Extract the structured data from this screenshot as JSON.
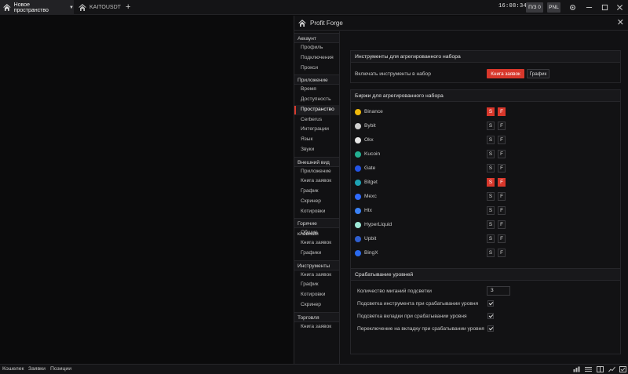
{
  "titlebar": {
    "workspace_tab": "Новое пространство",
    "symbol_tab": "KAITOUSDT",
    "clock": "16:08:34",
    "pz_button": "П/З 0",
    "pnl_button": "PNL"
  },
  "panel": {
    "title": "Profit Forge"
  },
  "nav": {
    "groups": [
      {
        "label": "Аккаунт",
        "items": [
          "Профиль",
          "Подключения",
          "Прокси"
        ]
      },
      {
        "label": "Приложение",
        "items": [
          "Время",
          "Доступность",
          "Пространство",
          "Cerberus",
          "Интеграции",
          "Язык",
          "Звуки"
        ]
      },
      {
        "label": "Внешний вид",
        "items": [
          "Приложение",
          "Книга заявок",
          "График",
          "Скринер",
          "Котировки"
        ]
      },
      {
        "label": "Горячие клавиши",
        "items": [
          "Общие",
          "Книга заявок",
          "Графики"
        ]
      },
      {
        "label": "Инструменты",
        "items": [
          "Книга заявок",
          "График",
          "Котировки",
          "Скринер"
        ]
      },
      {
        "label": "Торговля",
        "items": [
          "Книга заявок"
        ]
      }
    ],
    "active": "Пространство"
  },
  "instruments_section": {
    "title": "Инструменты для агрегированного набора",
    "row_label": "Включать инструменты в набор",
    "btn_orderbook": "Книга заявок",
    "btn_chart": "График",
    "orderbook_selected": true
  },
  "exchanges_section": {
    "title": "Биржи для агрегированного набора",
    "spot_label": "S",
    "futures_label": "F",
    "exchanges": [
      {
        "name": "Binance",
        "icon": "binance-icon",
        "color": "#f0b90b",
        "spot": true,
        "futures": true
      },
      {
        "name": "Bybit",
        "icon": "bybit-icon",
        "color": "#cfcfcf",
        "spot": false,
        "futures": false
      },
      {
        "name": "Okx",
        "icon": "okx-icon",
        "color": "#e6e6e6",
        "spot": false,
        "futures": false
      },
      {
        "name": "Kucoin",
        "icon": "kucoin-icon",
        "color": "#23af91",
        "spot": false,
        "futures": false
      },
      {
        "name": "Gate",
        "icon": "gate-icon",
        "color": "#2354e6",
        "spot": false,
        "futures": false
      },
      {
        "name": "Bitget",
        "icon": "bitget-icon",
        "color": "#1da2b4",
        "spot": true,
        "futures": true
      },
      {
        "name": "Mexc",
        "icon": "mexc-icon",
        "color": "#2f6bff",
        "spot": false,
        "futures": false
      },
      {
        "name": "Htx",
        "icon": "htx-icon",
        "color": "#3b82f6",
        "spot": false,
        "futures": false
      },
      {
        "name": "HyperLiquid",
        "icon": "hyperliquid-icon",
        "color": "#9de7d6",
        "spot": false,
        "futures": false
      },
      {
        "name": "Upbit",
        "icon": "upbit-icon",
        "color": "#2f5fd0",
        "spot": false,
        "futures": false
      },
      {
        "name": "BingX",
        "icon": "bingx-icon",
        "color": "#2a6af0",
        "spot": false,
        "futures": false
      }
    ]
  },
  "levels_section": {
    "title": "Срабатывание уровней",
    "blink_label": "Количество миганий подсветки",
    "blink_value": "3",
    "highlight_instrument_label": "Подсветка инструмента при срабатывании уровня",
    "highlight_tab_label": "Подсветка вкладки при срабатывании уровня",
    "switch_tab_label": "Переключение на вкладку при срабатывании уровня",
    "highlight_instrument": true,
    "highlight_tab": true,
    "switch_tab": true
  },
  "statusbar": {
    "wallet": "Кошелек",
    "orders": "Заявки",
    "positions": "Позиции"
  },
  "colors": {
    "accent": "#d8372b",
    "background": "#0b0b0c",
    "panel": "#111113"
  }
}
